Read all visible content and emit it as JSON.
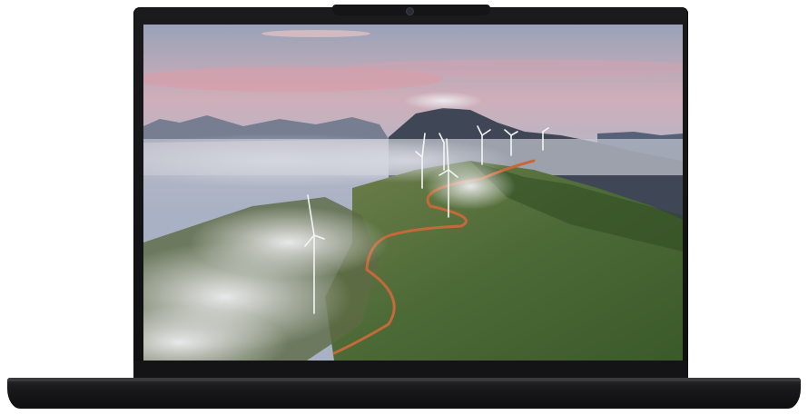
{
  "product": {
    "device": "laptop",
    "screen_content": "wind-turbines-on-misty-mountain-ridge"
  },
  "colors": {
    "bezel": "#151517",
    "base": "#1a1a1c",
    "sky_top": "#c9b9c8",
    "sky_pink": "#d9a3aa",
    "mountain": "#3f4656",
    "grass": "#5a7a3c",
    "road": "#c46a3a"
  }
}
